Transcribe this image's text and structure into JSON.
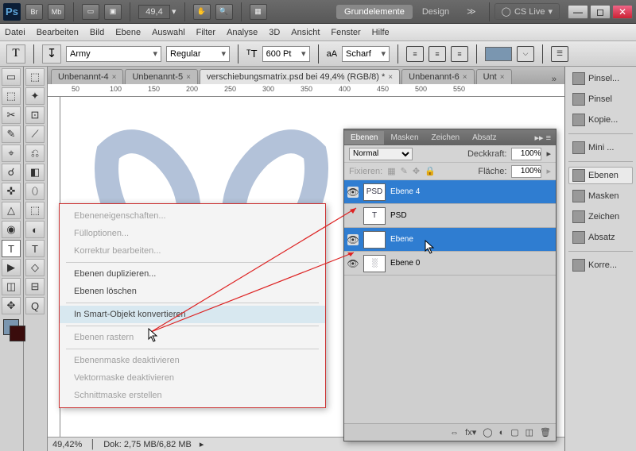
{
  "topbar": {
    "logo": "Ps",
    "zoom": "49,4",
    "ws_active": "Grundelemente",
    "ws_other": "Design",
    "cslive": "CS Live"
  },
  "menu": [
    "Datei",
    "Bearbeiten",
    "Bild",
    "Ebene",
    "Auswahl",
    "Filter",
    "Analyse",
    "3D",
    "Ansicht",
    "Fenster",
    "Hilfe"
  ],
  "options": {
    "font": "Army",
    "weight": "Regular",
    "size": "600 Pt",
    "aa_label": "aA",
    "aa": "Scharf"
  },
  "doc_tabs": [
    {
      "label": "Unbenannt-4",
      "active": false
    },
    {
      "label": "Unbenannt-5",
      "active": false
    },
    {
      "label": "verschiebungsmatrix.psd bei 49,4% (RGB/8) *",
      "active": true
    },
    {
      "label": "Unbenannt-6",
      "active": false
    },
    {
      "label": "Unt",
      "active": false
    }
  ],
  "ruler_marks": [
    50,
    100,
    150,
    200,
    250,
    300,
    350,
    400,
    450,
    500,
    550
  ],
  "status": {
    "zoom": "49,42%",
    "doc": "Dok: 2,75 MB/6,82 MB"
  },
  "right_panel": [
    {
      "label": "Pinsel...",
      "icon": "brush"
    },
    {
      "label": "Pinsel",
      "icon": "brush2"
    },
    {
      "label": "Kopie...",
      "icon": "clone"
    },
    {
      "sep": true
    },
    {
      "label": "Mini ...",
      "icon": "mb"
    },
    {
      "sep": true
    },
    {
      "label": "Ebenen",
      "icon": "layers",
      "active": true
    },
    {
      "label": "Masken",
      "icon": "mask"
    },
    {
      "label": "Zeichen",
      "icon": "char"
    },
    {
      "label": "Absatz",
      "icon": "para"
    },
    {
      "sep": true
    },
    {
      "label": "Korre...",
      "icon": "adj"
    }
  ],
  "layers_panel": {
    "tabs": [
      "Ebenen",
      "Masken",
      "Zeichen",
      "Absatz"
    ],
    "blend": "Normal",
    "opacity_label": "Deckkraft:",
    "opacity": "100%",
    "lock_label": "Fixieren:",
    "fill_label": "Fläche:",
    "fill": "100%",
    "layers": [
      {
        "name": "Ebene 4",
        "sel": true,
        "eye": true,
        "thumb": "PSD"
      },
      {
        "name": "PSD",
        "sel": false,
        "eye": false,
        "thumb": "T"
      },
      {
        "name": "Ebene",
        "sel": true,
        "eye": true,
        "thumb": ""
      },
      {
        "name": "Ebene 0",
        "sel": false,
        "eye": true,
        "thumb": "░"
      }
    ]
  },
  "context_menu": [
    {
      "label": "Ebeneneigenschaften...",
      "disabled": true
    },
    {
      "label": "Fülloptionen...",
      "disabled": true
    },
    {
      "label": "Korrektur bearbeiten...",
      "disabled": true
    },
    {
      "sep": true
    },
    {
      "label": "Ebenen duplizieren..."
    },
    {
      "label": "Ebenen löschen"
    },
    {
      "sep": true
    },
    {
      "label": "In Smart-Objekt konvertieren",
      "hover": true
    },
    {
      "sep": true
    },
    {
      "label": "Ebenen rastern",
      "disabled": true
    },
    {
      "sep": true
    },
    {
      "label": "Ebenenmaske deaktivieren",
      "disabled": true
    },
    {
      "label": "Vektormaske deaktivieren",
      "disabled": true
    },
    {
      "label": "Schnittmaske erstellen",
      "disabled": true
    }
  ]
}
